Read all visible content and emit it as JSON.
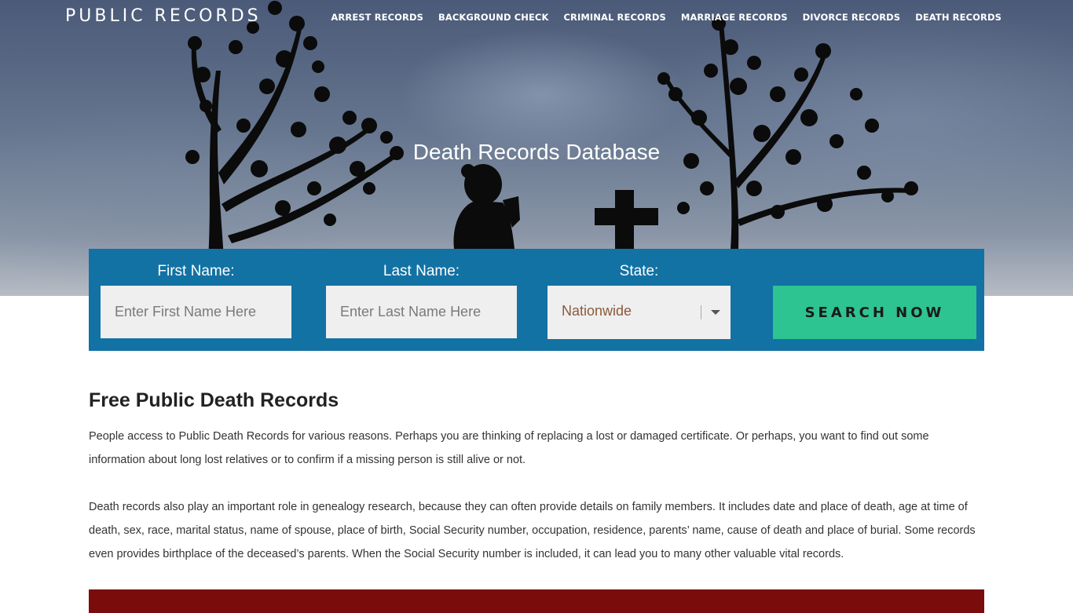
{
  "site": {
    "logo": "PUBLIC RECORDS"
  },
  "nav": [
    {
      "label": "ARREST RECORDS"
    },
    {
      "label": "BACKGROUND CHECK"
    },
    {
      "label": "CRIMINAL RECORDS"
    },
    {
      "label": "MARRIAGE RECORDS"
    },
    {
      "label": "DIVORCE RECORDS"
    },
    {
      "label": "DEATH RECORDS"
    }
  ],
  "hero": {
    "title": "Death Records Database"
  },
  "search": {
    "first_name_label": "First Name:",
    "first_name_placeholder": "Enter First Name Here",
    "last_name_label": "Last Name:",
    "last_name_placeholder": "Enter Last Name Here",
    "state_label": "State:",
    "state_value": "Nationwide",
    "button_label": "SEARCH NOW"
  },
  "content": {
    "heading": "Free Public Death Records",
    "paragraph1": "People access to Public Death Records for various reasons. Perhaps you are thinking of replacing a lost or damaged certificate. Or perhaps, you want to find out some information about long lost relatives or to confirm if a missing person is still alive or not.",
    "paragraph2": "Death records also play an important role in genealogy research, because they can often provide details on family members. It includes date and place of death, age at time of death, sex, race, marital status, name of spouse, place of birth, Social Security number, occupation, residence, parents’ name, cause of death and place of burial. Some records even provides birthplace of the deceased’s parents. When the Social Security number is included, it can lead you to many other valuable vital records."
  },
  "colors": {
    "panel": "#1272a4",
    "button": "#2ec492",
    "banner": "#7a0c0c"
  }
}
